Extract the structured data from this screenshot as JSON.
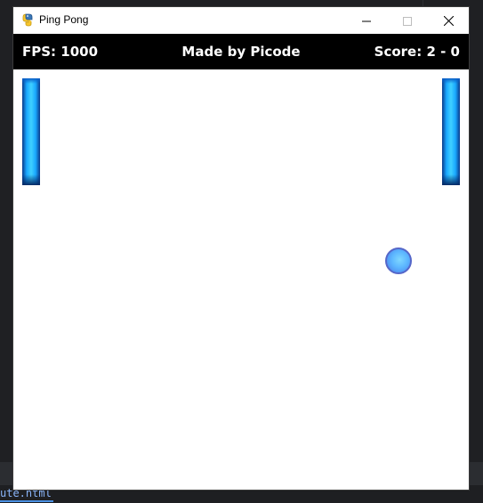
{
  "window": {
    "title": "Ping Pong",
    "app_icon": "pygame-snake-icon"
  },
  "controls": {
    "minimize_icon": "minimize-icon",
    "maximize_icon": "maximize-icon",
    "close_icon": "close-icon"
  },
  "hud": {
    "fps": "FPS: 1000",
    "credit": "Made by Picode",
    "score": "Score: 2 - 0"
  },
  "game": {
    "colors": {
      "paddle": "#19a8ff",
      "ball": "#5cb6ff",
      "hud_background": "#000000",
      "field_background": "#ffffff"
    }
  },
  "taskbar": {
    "file_link": "ute.html"
  }
}
